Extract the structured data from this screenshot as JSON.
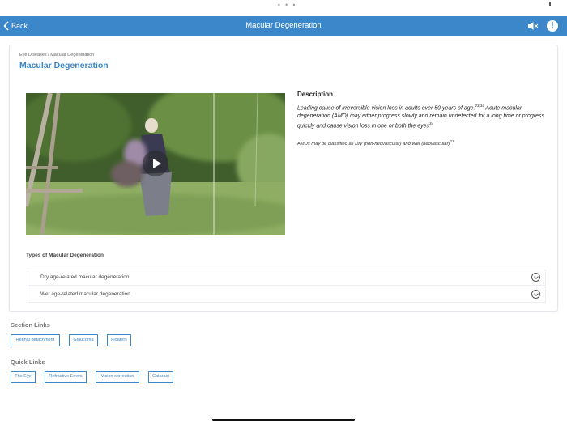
{
  "nav": {
    "back_label": "Back",
    "title": "Macular Degeneration",
    "alert_glyph": "!"
  },
  "status": {
    "dots": "• • •"
  },
  "page": {
    "breadcrumb": "Eye Diseases / Macular Degeneration",
    "title": "Macular Degeneration"
  },
  "description": {
    "heading": "Description",
    "main_text": "Leading cause of irreversible vision loss in adults over 50 years of age.",
    "main_ref": "23,34",
    "main_text_2": " Acute macular degeneration (AMD) may either progress slowly and remain undetected for a long time or progress quickly and cause vision loss in one or both the eyes",
    "main_ref_2": "34",
    "sub_text": "AMDs may be classified as Dry (non-neovascular) and Wet (neovascular)",
    "sub_ref": "23"
  },
  "types": {
    "heading": "Types of Macular Degeneration",
    "items": [
      {
        "label": "Dry age-related macular degeneration"
      },
      {
        "label": "Wet age-related macular degeneration"
      }
    ]
  },
  "section_links": {
    "heading": "Section Links",
    "items": [
      {
        "label": "Retinal detachment"
      },
      {
        "label": "Glaucoma"
      },
      {
        "label": "Floaters"
      }
    ]
  },
  "quick_links": {
    "heading": "Quick Links",
    "items": [
      {
        "label": "The Eye"
      },
      {
        "label": "Refractive Errors"
      },
      {
        "label": "Vision correction"
      },
      {
        "label": "Cataract"
      }
    ]
  },
  "icons": {
    "back": "chevron-left-icon",
    "sound": "speaker-muted-icon",
    "alert": "exclamation-icon",
    "play": "play-icon",
    "accordion": "chevron-down-circle-icon"
  },
  "colors": {
    "accent": "#3b87c9",
    "navbar": "#3b87c9"
  }
}
